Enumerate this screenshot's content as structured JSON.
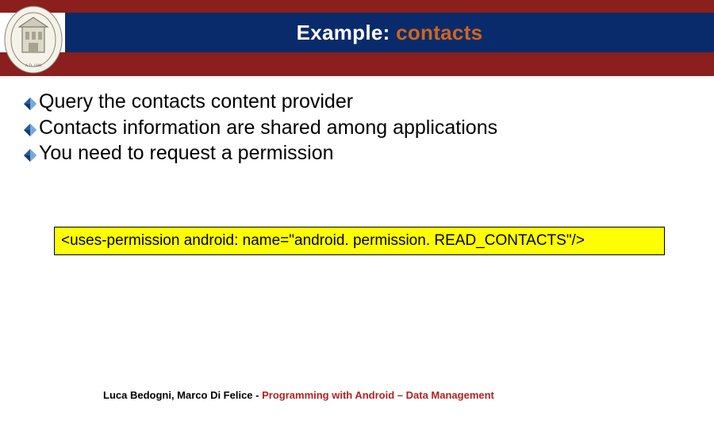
{
  "header": {
    "prefix": "Example: ",
    "accent": "contacts"
  },
  "bullets": [
    "Query the contacts content provider",
    "Contacts information are shared among applications",
    "You need to request a permission"
  ],
  "code": "<uses-permission android: name=\"android. permission. READ_CONTACTS\"/>",
  "footer": {
    "authors": "Luca Bedogni, Marco Di Felice",
    "dash": " - ",
    "subtitle": "Programming with Android – Data Management"
  }
}
